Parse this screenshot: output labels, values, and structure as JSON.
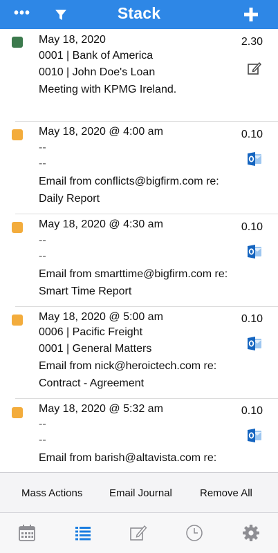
{
  "header": {
    "title": "Stack",
    "more_icon": "ellipsis-icon",
    "filter_icon": "filter-icon",
    "add_icon": "plus-icon",
    "accent_color": "#2e87e6"
  },
  "entries": [
    {
      "status_color": "#3c7a4d",
      "date": "May 18, 2020",
      "line1": "0001 | Bank of America",
      "line2": "0010 | John Doe's Loan",
      "desc1": "Meeting with KPMG Ireland.",
      "desc2": "",
      "hours": "2.30",
      "action_icon": "edit-note-icon"
    },
    {
      "status_color": "#f3ac3c",
      "date": "May 18, 2020 @ 4:00 am",
      "line1": "--",
      "line2": "--",
      "desc1": "Email from conflicts@bigfirm.com re:",
      "desc2": "Daily Report",
      "hours": "0.10",
      "action_icon": "outlook-icon"
    },
    {
      "status_color": "#f3ac3c",
      "date": "May 18, 2020 @ 4:30 am",
      "line1": "--",
      "line2": "--",
      "desc1": "Email from smarttime@bigfirm.com re:",
      "desc2": "Smart Time Report",
      "hours": "0.10",
      "action_icon": "outlook-icon"
    },
    {
      "status_color": "#f3ac3c",
      "date": "May 18, 2020 @ 5:00 am",
      "line1": "0006 | Pacific Freight",
      "line2": "0001 | General Matters",
      "desc1": "Email from nick@heroictech.com re:",
      "desc2": "Contract - Agreement",
      "hours": "0.10",
      "action_icon": "outlook-icon"
    },
    {
      "status_color": "#f3ac3c",
      "date": "May 18, 2020 @ 5:32 am",
      "line1": "--",
      "line2": "--",
      "desc1": "Email from barish@altavista.com re:",
      "desc2": "",
      "hours": "0.10",
      "action_icon": "outlook-icon"
    }
  ],
  "actions": {
    "mass_actions": "Mass Actions",
    "email_journal": "Email Journal",
    "remove_all": "Remove All"
  },
  "tabs": [
    {
      "name": "calendar-icon",
      "active": false
    },
    {
      "name": "list-icon",
      "active": true
    },
    {
      "name": "edit-note-icon",
      "active": false
    },
    {
      "name": "clock-icon",
      "active": false
    },
    {
      "name": "gear-icon",
      "active": false
    }
  ]
}
